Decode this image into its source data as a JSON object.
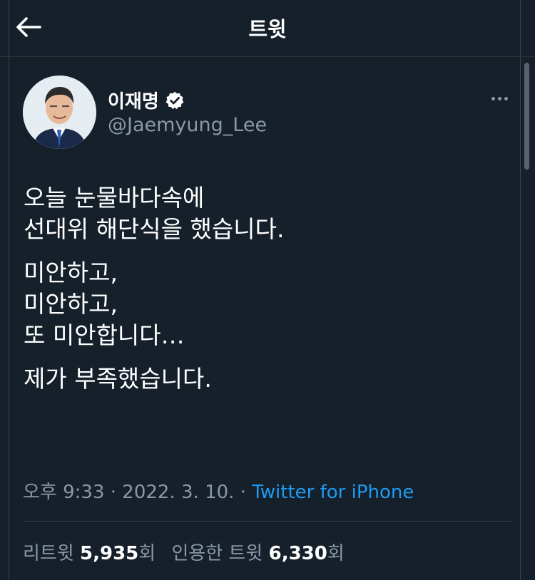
{
  "header": {
    "title": "트윗"
  },
  "user": {
    "display_name": "이재명",
    "handle": "@Jaemyung_Lee",
    "verified": true
  },
  "tweet": {
    "paragraphs": [
      [
        "오늘 눈물바다속에",
        "선대위 해단식을 했습니다."
      ],
      [
        "미안하고,",
        "미안하고,",
        "또 미안합니다…"
      ],
      [
        "제가 부족했습니다."
      ]
    ],
    "time": "오후 9:33",
    "date": "2022. 3. 10.",
    "separator": "·",
    "source": "Twitter for iPhone"
  },
  "stats": {
    "retweets_label": "리트윗",
    "retweets_count": "5,935",
    "retweets_unit": "회",
    "quotes_label": "인용한 트윗",
    "quotes_count": "6,330",
    "quotes_unit": "회"
  },
  "colors": {
    "background": "#15202b",
    "accent": "#1d9bf0",
    "secondary_text": "#8b98a5"
  }
}
